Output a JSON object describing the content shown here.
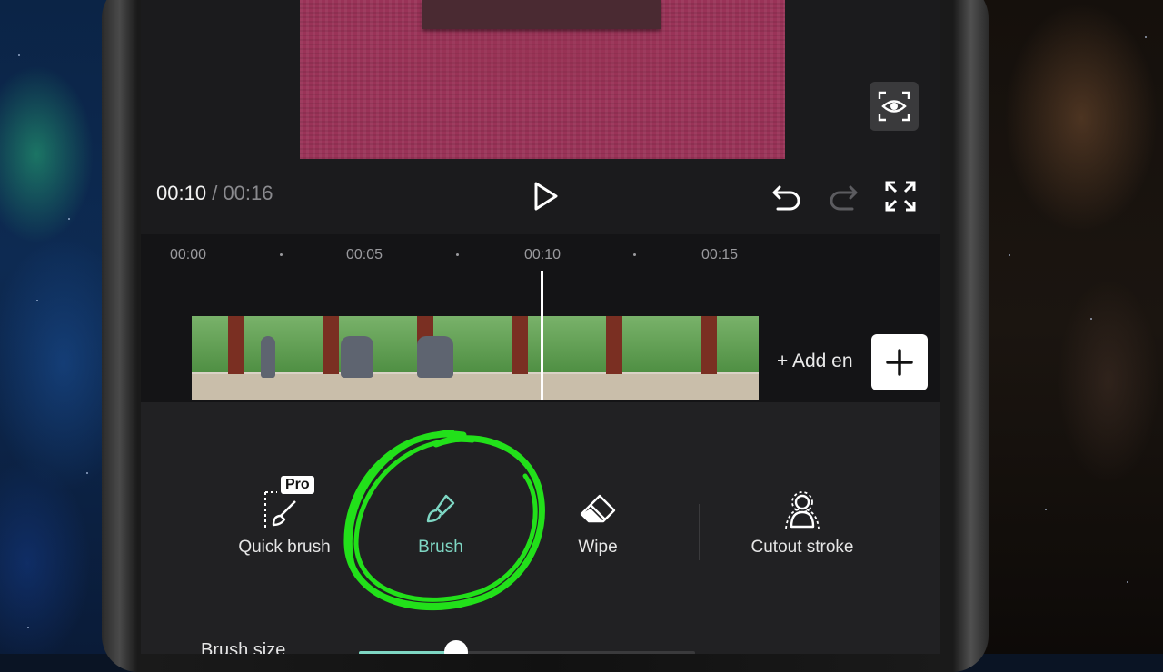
{
  "player": {
    "current_time": "00:10",
    "separator": "/",
    "total_time": "00:16"
  },
  "timeline": {
    "ticks": [
      "00:00",
      "00:05",
      "00:10",
      "00:15"
    ],
    "add_ending_label": "+ Add en"
  },
  "tools": {
    "quick_brush": {
      "label": "Quick brush",
      "badge": "Pro"
    },
    "brush": {
      "label": "Brush"
    },
    "wipe": {
      "label": "Wipe"
    },
    "cutout_stroke": {
      "label": "Cutout stroke"
    }
  },
  "brush_size": {
    "label": "Brush size",
    "value": 0.29
  },
  "colors": {
    "accent": "#7ed6c3",
    "highlight_scribble": "#22e01a",
    "panel_bg": "#212123"
  },
  "icons": {
    "eye": "eye-icon",
    "play": "play-icon",
    "undo": "undo-icon",
    "redo": "redo-icon",
    "fullscreen": "fullscreen-icon",
    "add": "plus-icon"
  }
}
